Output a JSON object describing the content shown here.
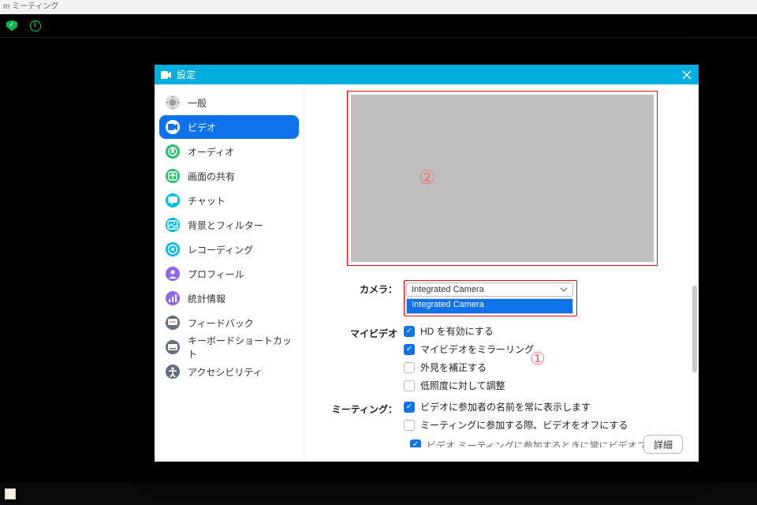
{
  "window": {
    "app_title": "m ミーティング"
  },
  "settings": {
    "title": "設定",
    "sidebar": [
      {
        "id": "general",
        "label": "一般",
        "icon": "gear",
        "fill": "#d9d9d9",
        "glyph": "#999"
      },
      {
        "id": "video",
        "label": "ビデオ",
        "icon": "video",
        "fill": "#ffffff",
        "glyph": "#0e72ed",
        "active": true
      },
      {
        "id": "audio",
        "label": "オーディオ",
        "icon": "audio",
        "fill": "#2dbf6d",
        "glyph": "#fff"
      },
      {
        "id": "share",
        "label": "画面の共有",
        "icon": "share",
        "fill": "#2dbf6d",
        "glyph": "#fff"
      },
      {
        "id": "chat",
        "label": "チャット",
        "icon": "chat",
        "fill": "#00bde4",
        "glyph": "#fff"
      },
      {
        "id": "bgfilter",
        "label": "背景とフィルター",
        "icon": "picture",
        "fill": "#00bde4",
        "glyph": "#fff"
      },
      {
        "id": "recording",
        "label": "レコーディング",
        "icon": "record",
        "fill": "#00bde4",
        "glyph": "#fff"
      },
      {
        "id": "profile",
        "label": "プロフィール",
        "icon": "profile",
        "fill": "#8f66ee",
        "glyph": "#fff"
      },
      {
        "id": "stats",
        "label": "統計情報",
        "icon": "stats",
        "fill": "#8f66ee",
        "glyph": "#fff"
      },
      {
        "id": "feedback",
        "label": "フィードバック",
        "icon": "feedback",
        "fill": "#666e7b",
        "glyph": "#fff"
      },
      {
        "id": "shortcut",
        "label": "キーボードショートカット",
        "icon": "keyboard",
        "fill": "#666e7b",
        "glyph": "#fff"
      },
      {
        "id": "a11y",
        "label": "アクセシビリティ",
        "icon": "a11y",
        "fill": "#666e7b",
        "glyph": "#fff"
      }
    ],
    "video": {
      "camera_label": "カメラ：",
      "camera_selected": "Integrated Camera",
      "camera_options": [
        "Integrated Camera"
      ],
      "myvideo_label": "マイビデオ",
      "myvideo_opts": [
        {
          "id": "hd",
          "label": "HD を有効にする",
          "checked": true
        },
        {
          "id": "mirror",
          "label": "マイビデオをミラーリング",
          "checked": true
        },
        {
          "id": "touchup",
          "label": "外見を補正する",
          "checked": false
        },
        {
          "id": "lowlight",
          "label": "低照度に対して調整",
          "checked": false
        }
      ],
      "meeting_label": "ミーティング：",
      "meeting_opts": [
        {
          "id": "shownames",
          "label": "ビデオに参加者の名前を常に表示します",
          "checked": true
        },
        {
          "id": "offonjoin",
          "label": "ミーティングに参加する際、ビデオをオフにする",
          "checked": false
        }
      ],
      "cut_line": "ビデオ ミーティングに参加するときに常にビデオプレビューダイアログを表示します",
      "advanced_label": "詳細"
    },
    "annotations": {
      "one": "①",
      "two": "②"
    }
  }
}
